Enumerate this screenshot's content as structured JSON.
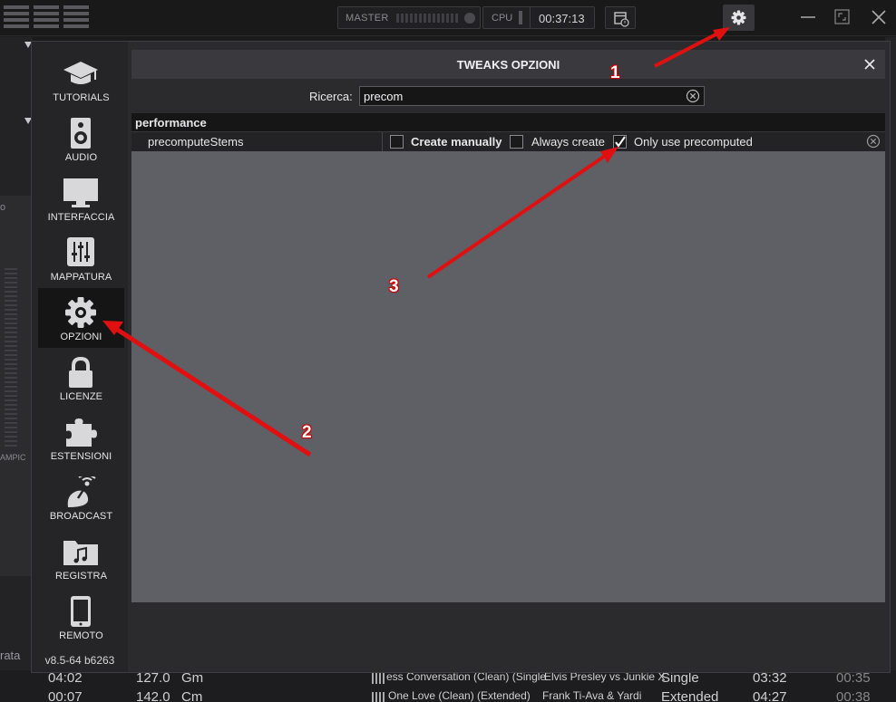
{
  "topbar": {
    "master_label": "MASTER",
    "cpu_label": "CPU",
    "clock": "00:37:13"
  },
  "background": {
    "left_cut_1": "o",
    "left_cut_2": "AMPIC",
    "left_cut_3": "rata",
    "rows": [
      {
        "time": "04:02",
        "bpm": "127.0",
        "key": "Gm",
        "title": "ess Conversation (Clean) (Single",
        "artist": "Elvis Presley vs Junkie X",
        "type": "Single",
        "length": "03:32",
        "extra": "00:35"
      },
      {
        "time": "00:07",
        "bpm": "142.0",
        "key": "Cm",
        "title": "One Love (Clean) (Extended)",
        "artist": "Frank Ti-Ava & Yardi",
        "type": "Extended",
        "length": "04:27",
        "extra": "00:38"
      }
    ]
  },
  "sidebar": {
    "items": [
      {
        "label": "TUTORIALS",
        "icon": "graduation-cap-icon"
      },
      {
        "label": "AUDIO",
        "icon": "speaker-icon"
      },
      {
        "label": "INTERFACCIA",
        "icon": "monitor-icon"
      },
      {
        "label": "MAPPATURA",
        "icon": "mixer-sliders-icon"
      },
      {
        "label": "OPZIONI",
        "icon": "gear-icon",
        "active": true
      },
      {
        "label": "LICENZE",
        "icon": "lock-icon"
      },
      {
        "label": "ESTENSIONI",
        "icon": "puzzle-icon"
      },
      {
        "label": "BROADCAST",
        "icon": "broadcast-icon"
      },
      {
        "label": "REGISTRA",
        "icon": "music-folder-icon"
      },
      {
        "label": "REMOTO",
        "icon": "phone-icon"
      }
    ],
    "version": "v8.5-64 b6263"
  },
  "dialog": {
    "title": "TWEAKS OPZIONI",
    "search_label": "Ricerca:",
    "search_value": "precom",
    "category": "performance",
    "option": {
      "name": "precomputeStems",
      "choices": [
        {
          "label": "Create manually",
          "checked": false,
          "bold": true
        },
        {
          "label": "Always create",
          "checked": false,
          "bold": false
        },
        {
          "label": "Only use precomputed",
          "checked": true,
          "bold": false
        }
      ]
    }
  },
  "annotations": [
    "1",
    "2",
    "3"
  ],
  "colors": {
    "arrow": "#e01010",
    "results_bg": "#5f5f66",
    "active_sidebar": "#151516"
  }
}
